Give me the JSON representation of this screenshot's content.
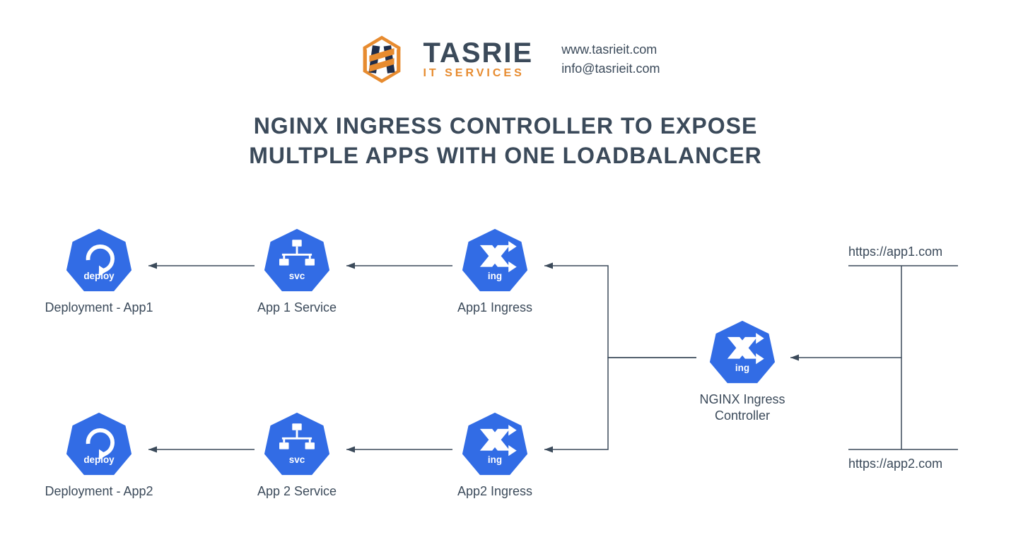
{
  "brand": {
    "name": "TASRIE",
    "tagline": "IT SERVICES"
  },
  "contact": {
    "website": "www.tasrieit.com",
    "email": "info@tasrieit.com"
  },
  "title_line1": "NGINX INGRESS CONTROLLER TO EXPOSE",
  "title_line2": "MULTPLE APPS WITH ONE LOADBALANCER",
  "nodes": {
    "deploy1": {
      "label": "Deployment - App1",
      "badge": "deploy"
    },
    "deploy2": {
      "label": "Deployment - App2",
      "badge": "deploy"
    },
    "svc1": {
      "label": "App 1 Service",
      "badge": "svc"
    },
    "svc2": {
      "label": "App 2 Service",
      "badge": "svc"
    },
    "ing1": {
      "label": "App1 Ingress",
      "badge": "ing"
    },
    "ing2": {
      "label": "App2 Ingress",
      "badge": "ing"
    },
    "ctrl": {
      "label": "NGINX Ingress Controller",
      "badge": "ing"
    }
  },
  "urls": {
    "app1": "https://app1.com",
    "app2": "https://app2.com"
  },
  "colors": {
    "hex": "#326ce5",
    "text": "#3b4a5a",
    "orange": "#e78b2f",
    "navy": "#1f2d4a"
  }
}
